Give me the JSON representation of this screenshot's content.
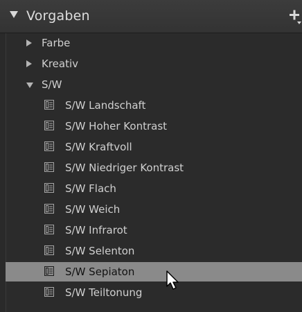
{
  "header": {
    "title": "Vorgaben",
    "add_icon": "plus-dropdown-icon"
  },
  "folders": [
    {
      "label": "Farbe",
      "expanded": false
    },
    {
      "label": "Kreativ",
      "expanded": false
    },
    {
      "label": "S/W",
      "expanded": true
    }
  ],
  "presets": [
    {
      "label": "S/W Landschaft"
    },
    {
      "label": "S/W Hoher Kontrast"
    },
    {
      "label": "S/W Kraftvoll"
    },
    {
      "label": "S/W Niedriger Kontrast"
    },
    {
      "label": "S/W Flach"
    },
    {
      "label": "S/W Weich"
    },
    {
      "label": "S/W Infrarot"
    },
    {
      "label": "S/W Selenton"
    },
    {
      "label": "S/W Sepiaton",
      "selected": true
    },
    {
      "label": "S/W Teiltonung"
    }
  ],
  "colors": {
    "background": "#2a2a2a",
    "selected_row": "#8a8a8a",
    "text": "#d0d0d0",
    "selected_text": "#111111"
  }
}
